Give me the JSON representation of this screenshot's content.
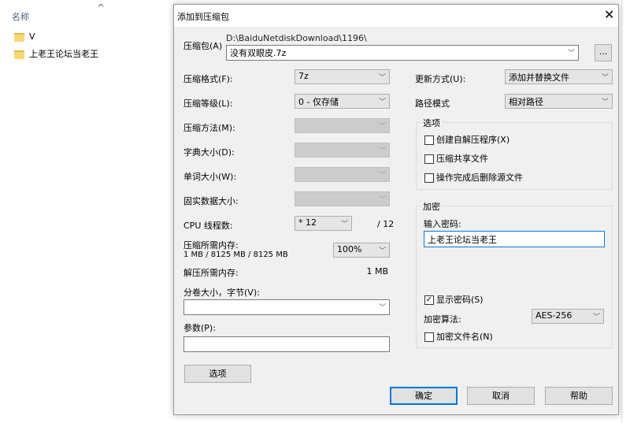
{
  "explorer": {
    "column_name": "名称",
    "items": [
      "V",
      "上老王论坛当老王"
    ]
  },
  "dialog": {
    "title": "添加到压缩包",
    "archive_label": "压缩包(A)",
    "archive_path": "D:\\BaiduNetdiskDownload\\1196\\",
    "archive_name": "没有双眼皮.7z",
    "browse_label": "...",
    "format_label": "压缩格式(F):",
    "format_value": "7z",
    "level_label": "压缩等级(L):",
    "level_value": "0 - 仅存储",
    "method_label": "压缩方法(M):",
    "dict_label": "字典大小(D):",
    "word_label": "单词大小(W):",
    "solid_label": "固实数据大小:",
    "cpu_label": "CPU 线程数:",
    "cpu_value": "* 12",
    "cpu_max": "/ 12",
    "mem_comp_label": "压缩所需内存:",
    "mem_comp_value": "1 MB / 8125 MB / 8125 MB",
    "mem_percent": "100%",
    "mem_decomp_label": "解压所需内存:",
    "mem_decomp_value": "1 MB",
    "split_label": "分卷大小，字节(V):",
    "split_value": "",
    "params_label": "参数(P):",
    "params_value": "",
    "options_button": "选项",
    "update_label": "更新方式(U):",
    "update_value": "添加并替换文件",
    "pathmode_label": "路径模式",
    "pathmode_value": "相对路径",
    "options_group": "选项",
    "opt_sfx": "创建自解压程序(X)",
    "opt_shared": "压缩共享文件",
    "opt_delete": "操作完成后删除源文件",
    "enc_group": "加密",
    "password_label": "输入密码:",
    "password_value": "上老王论坛当老王",
    "show_password": "显示密码(S)",
    "show_password_checked": true,
    "enc_method_label": "加密算法:",
    "enc_method_value": "AES-256",
    "enc_names": "加密文件名(N)",
    "ok": "确定",
    "cancel": "取消",
    "help": "帮助"
  }
}
